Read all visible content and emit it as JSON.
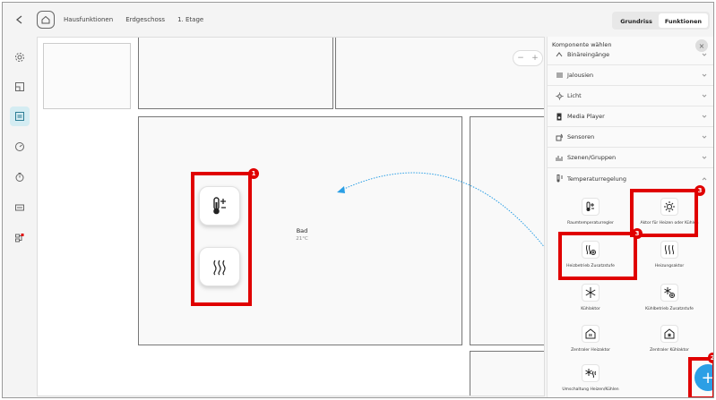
{
  "breadcrumb": [
    "Hausfunktionen",
    "Erdgeschoss",
    "1. Etage"
  ],
  "view_toggle": {
    "grundriss": "Grundriss",
    "funktionen": "Funktionen",
    "active": "funktionen"
  },
  "left_nav": [
    "settings-icon",
    "floorplan-icon",
    "dashboard-icon",
    "speedometer-icon",
    "timer-icon",
    "display-icon",
    "network-icon"
  ],
  "zoom": {
    "minus": "−",
    "plus": "+"
  },
  "room": {
    "name": "Bad",
    "temperature": "21°C"
  },
  "panel": {
    "title": "Komponente wählen",
    "categories": [
      {
        "label": "Binäreingänge",
        "icon": "binary-input-icon"
      },
      {
        "label": "Jalousien",
        "icon": "blinds-icon"
      },
      {
        "label": "Licht",
        "icon": "light-icon"
      },
      {
        "label": "Media Player",
        "icon": "media-player-icon"
      },
      {
        "label": "Sensoren",
        "icon": "sensor-icon"
      },
      {
        "label": "Szenen/Gruppen",
        "icon": "scenes-icon"
      },
      {
        "label": "Temperaturregelung",
        "icon": "thermostat-icon",
        "expanded": true
      }
    ],
    "components": [
      {
        "label": "Raumtemperaturregler",
        "icon": "thermometer-icon"
      },
      {
        "label": "Aktor für Heizen oder Kühlen",
        "icon": "heat-cool-actuator-icon"
      },
      {
        "label": "Heizbetrieb Zusatzstufe",
        "icon": "heating-extra-stage-icon"
      },
      {
        "label": "Heizungsaktor",
        "icon": "heating-icon"
      },
      {
        "label": "Kühlaktor",
        "icon": "cooling-icon"
      },
      {
        "label": "Kühlbetrieb Zusatzstufe",
        "icon": "cooling-extra-stage-icon"
      },
      {
        "label": "Zentraler Heizaktor",
        "icon": "central-heating-icon"
      },
      {
        "label": "Zentraler Kühlaktor",
        "icon": "central-cooling-icon"
      },
      {
        "label": "Umschaltung Heizen/Kühlen",
        "icon": "heat-cool-switch-icon"
      }
    ]
  },
  "annotations": {
    "badge_1": "1",
    "badge_2": "2",
    "badge_3a": "3",
    "badge_3b": "3"
  },
  "colors": {
    "highlight": "#e00000",
    "accent": "#2b9fe5",
    "nav_active": "#d4ecf2",
    "arrow": "#2b9fe5"
  },
  "fab_label": "+"
}
